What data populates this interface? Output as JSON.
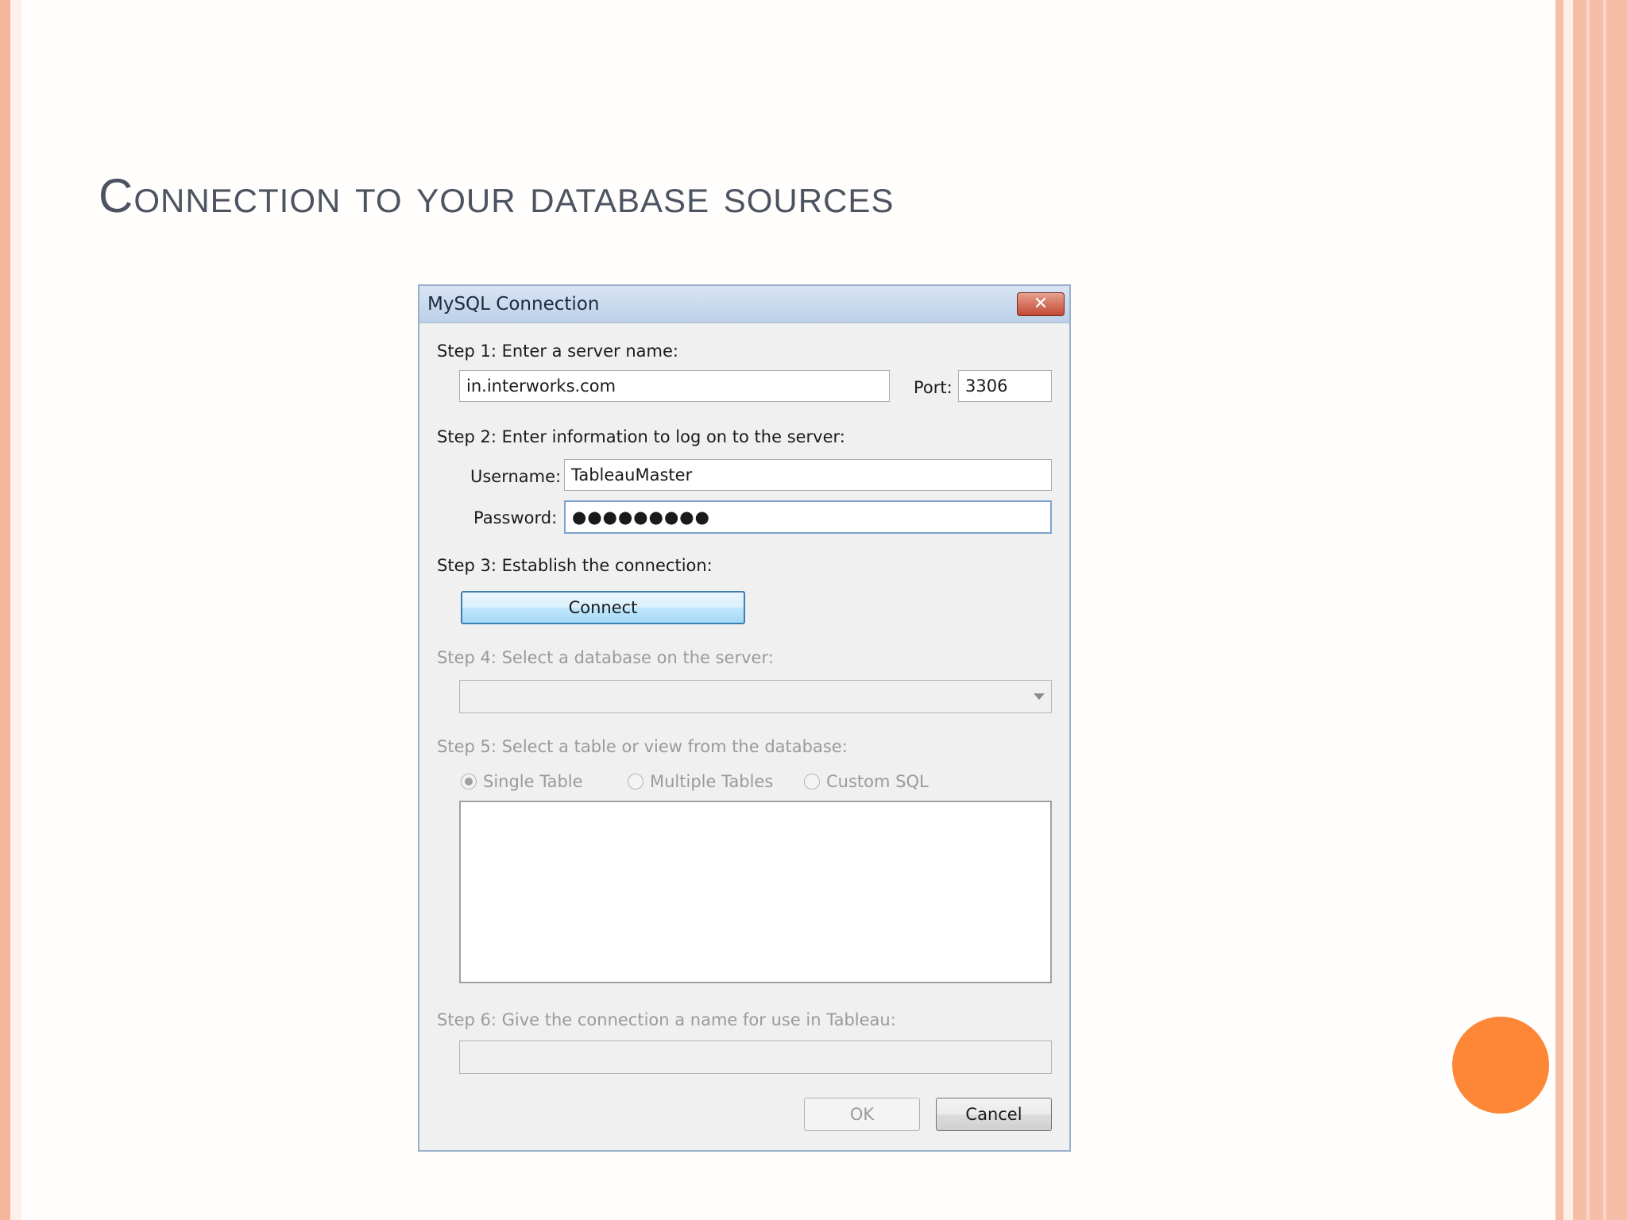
{
  "slide": {
    "title": "Connection to your database sources"
  },
  "dialog": {
    "title": "MySQL Connection",
    "close_symbol": "✕",
    "step1": {
      "label": "Step 1: Enter a server name:",
      "server_value": "in.interworks.com",
      "port_label": "Port:",
      "port_value": "3306"
    },
    "step2": {
      "label": "Step 2: Enter information to log on to the server:",
      "username_label": "Username:",
      "username_value": "TableauMaster",
      "password_label": "Password:",
      "password_value": "●●●●●●●●●"
    },
    "step3": {
      "label": "Step 3: Establish the connection:",
      "connect_label": "Connect"
    },
    "step4": {
      "label": "Step 4: Select a database on the server:",
      "selected": ""
    },
    "step5": {
      "label": "Step 5: Select a table or view from the database:",
      "options": [
        "Single Table",
        "Multiple Tables",
        "Custom SQL"
      ],
      "selected": "Single Table"
    },
    "step6": {
      "label": "Step 6: Give the connection a name for use in Tableau:",
      "name_value": ""
    },
    "ok_label": "OK",
    "cancel_label": "Cancel"
  },
  "colors": {
    "accent_orange": "#fd8637",
    "border_salmon": "#f5b69c",
    "title_text": "#4d5461"
  }
}
